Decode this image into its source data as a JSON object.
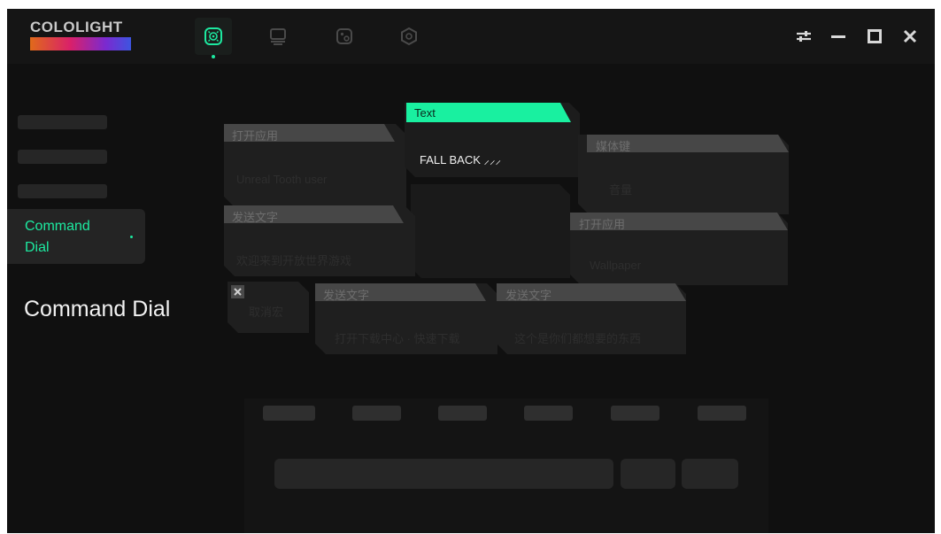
{
  "app": {
    "logo_text": "COLOLIGHT",
    "colors": {
      "accent": "#19f0a0",
      "background": "#101010",
      "card": "#1f1f1f",
      "card_header": "#474747"
    }
  },
  "nav_tabs": [
    {
      "name": "dial-tab",
      "icon": "dial-icon",
      "active": true
    },
    {
      "name": "monitor-tab",
      "icon": "monitor-icon",
      "active": false
    },
    {
      "name": "lighting-tab",
      "icon": "lighting-icon",
      "active": false
    },
    {
      "name": "settings-tab",
      "icon": "hexagon-icon",
      "active": false
    }
  ],
  "window_controls": [
    "sliders-icon",
    "minimize-icon",
    "maximize-icon",
    "close-icon"
  ],
  "sidebar": {
    "active_label": "Command\nDial"
  },
  "page": {
    "title": "Command Dial"
  },
  "dial_cards": {
    "top_center": {
      "label": "Text",
      "value": "FALL BACK ⸝⸝⸝"
    },
    "top_left": {
      "label": "打开应用",
      "value": "Unreal Tooth user"
    },
    "top_right": {
      "label": "媒体键",
      "value": "音量"
    },
    "mid_left": {
      "label": "发送文字",
      "value": "欢迎来到开放世界游戏"
    },
    "mid_right": {
      "label": "打开应用",
      "value": "Wallpaper"
    },
    "bottom_small": {
      "value": "取消宏"
    },
    "bottom_left": {
      "label": "发送文字",
      "value": "打开下载中心 · 快速下载"
    },
    "bottom_right": {
      "label": "发送文字",
      "value": "这个是你们都想要的东西"
    }
  }
}
